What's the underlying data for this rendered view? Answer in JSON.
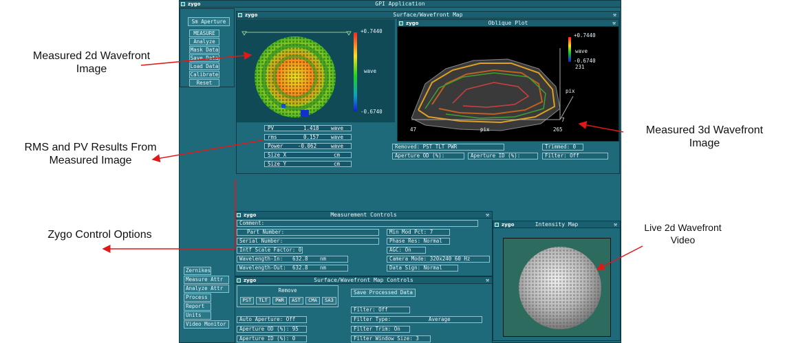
{
  "app_title": "GPI Application",
  "brand": "zygo",
  "left_menu": {
    "aperture_button": "Sm Aperture",
    "items": [
      "MEASURE",
      "Analyze",
      "Mask Data",
      "Save Data",
      "Load Data",
      "Calibrate",
      "Reset"
    ]
  },
  "bottom_menu": [
    "Zernikes",
    "Measure Attr",
    "Analyze Attr",
    "Process",
    "Report",
    "Units",
    "Video Monitor"
  ],
  "surface_map": {
    "title": "Surface/Wavefront Map",
    "scale_max": "+0.7440",
    "scale_min": "-0.6740",
    "scale_label": "wave"
  },
  "results": [
    {
      "label": "PV",
      "value": "1.418",
      "unit": "wave"
    },
    {
      "label": "rms",
      "value": "0.157",
      "unit": "wave"
    },
    {
      "label": "Power",
      "value": "-0.062",
      "unit": "wave"
    },
    {
      "label": "Size X",
      "value": "",
      "unit": "cm"
    },
    {
      "label": "Size Y",
      "value": "",
      "unit": "cm"
    }
  ],
  "oblique": {
    "title": "Oblique Plot",
    "scale_max": "+0.7440",
    "scale_label": "wave",
    "scale_min": "-0.6740",
    "z_max": "231",
    "x_start": "47",
    "x_label": "pix",
    "x_end": "265",
    "y_label": "pix",
    "y_start": "7"
  },
  "removed": "Removed: PST TLT PWR",
  "trimmed": "Trimmed:  0",
  "aperture_od": "Aperture OD (%):",
  "aperture_id": "Aperture ID (%):",
  "filter": "Filter:      Off",
  "measurement_controls": {
    "title": "Measurement Controls",
    "comment": "Comment:",
    "part_number": "Part Number:",
    "serial_number": "Serial Number:",
    "intf_scale": "Intf Scale Factor: 0.500",
    "wl_in_label": "Wavelength-In:",
    "wl_in_value": "632.8",
    "wl_in_unit": "nm",
    "wl_out_label": "Wavelength-Out:",
    "wl_out_value": "632.8",
    "wl_out_unit": "nm",
    "min_mod": "Min Mod Pct:   7",
    "phase_res": "Phase Res: Normal",
    "agc": "AGC:  On",
    "camera_mode": "Camera Mode:  320x240 60 Hz",
    "data_sign": "Data Sign:    Normal"
  },
  "intensity_map": {
    "title": "Intensity Map"
  },
  "map_controls": {
    "title": "Surface/Wavefront Map Controls",
    "remove_label": "Remove",
    "remove_options": [
      "PST",
      "TLT",
      "PWR",
      "AST",
      "CMA",
      "SA3"
    ],
    "save_processed": "Save Processed Data",
    "filter": "Filter:        Off",
    "filter_type_label": "Filter Type:",
    "filter_type_value": "Average",
    "filter_trim": "Filter Trim:  On",
    "filter_window": "Filter Window Size:  3",
    "auto_aperture": "Auto Aperture:  Off",
    "aperture_od": "Aperture OD (%):   95",
    "aperture_id": "Aperture ID (%):    0"
  },
  "annotations": {
    "measured_2d": "Measured 2d Wavefront\nImage",
    "rms_pv": "RMS and PV Results From\nMeasured Image",
    "measured_3d": "Measured 3d Wavefront\nImage",
    "control_options": "Zygo Control Options",
    "live_video": "Live 2d Wavefront\nVideo"
  }
}
